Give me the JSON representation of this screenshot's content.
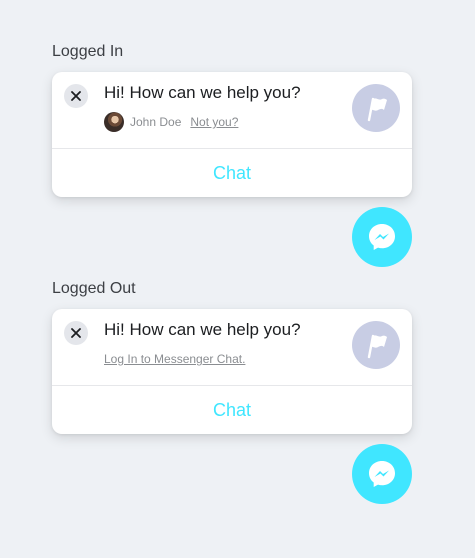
{
  "sections": [
    {
      "label": "Logged In",
      "greeting": "Hi! How can we help you?",
      "user_name": "John Doe",
      "not_you_link": "Not you?",
      "chat_label": "Chat"
    },
    {
      "label": "Logged Out",
      "greeting": "Hi! How can we help you?",
      "login_link": "Log In to Messenger Chat.",
      "chat_label": "Chat"
    }
  ],
  "colors": {
    "accent": "#40e6ff",
    "background": "#eef1f5",
    "page_logo_bg": "#c8cde4"
  },
  "icons": [
    "close-icon",
    "flag-icon",
    "messenger-icon",
    "avatar"
  ]
}
